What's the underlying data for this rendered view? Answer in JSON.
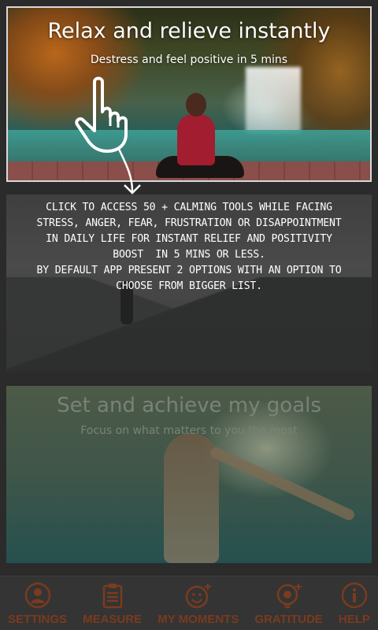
{
  "cards": {
    "relax": {
      "title": "Relax and relieve instantly",
      "subtitle": "Destress and feel positive in 5 mins"
    },
    "goals": {
      "title": "Set and achieve my goals",
      "subtitle": "Focus on what matters to you the most"
    }
  },
  "tooltip": {
    "line1": "CLICK TO ACCESS 50 + CALMING TOOLS WHILE FACING",
    "line2": "STRESS, ANGER, FEAR, FRUSTRATION OR DISAPPOINTMENT",
    "line3": "IN DAILY LIFE FOR INSTANT RELIEF AND POSITIVITY",
    "line4": "BOOST  IN 5 MINS OR LESS.",
    "line5": "BY DEFAULT APP PRESENT 2 OPTIONS WITH AN OPTION TO",
    "line6": "CHOOSE FROM BIGGER LIST."
  },
  "nav": {
    "items": [
      {
        "label": "SETTINGS",
        "icon": "person-icon"
      },
      {
        "label": "MEASURE",
        "icon": "clipboard-icon"
      },
      {
        "label": "MY MOMENTS",
        "icon": "smiley-plus-icon"
      },
      {
        "label": "GRATITUDE",
        "icon": "lightbulb-plus-icon"
      },
      {
        "label": "HELP",
        "icon": "info-icon"
      }
    ],
    "color": "#7a3b1e"
  }
}
